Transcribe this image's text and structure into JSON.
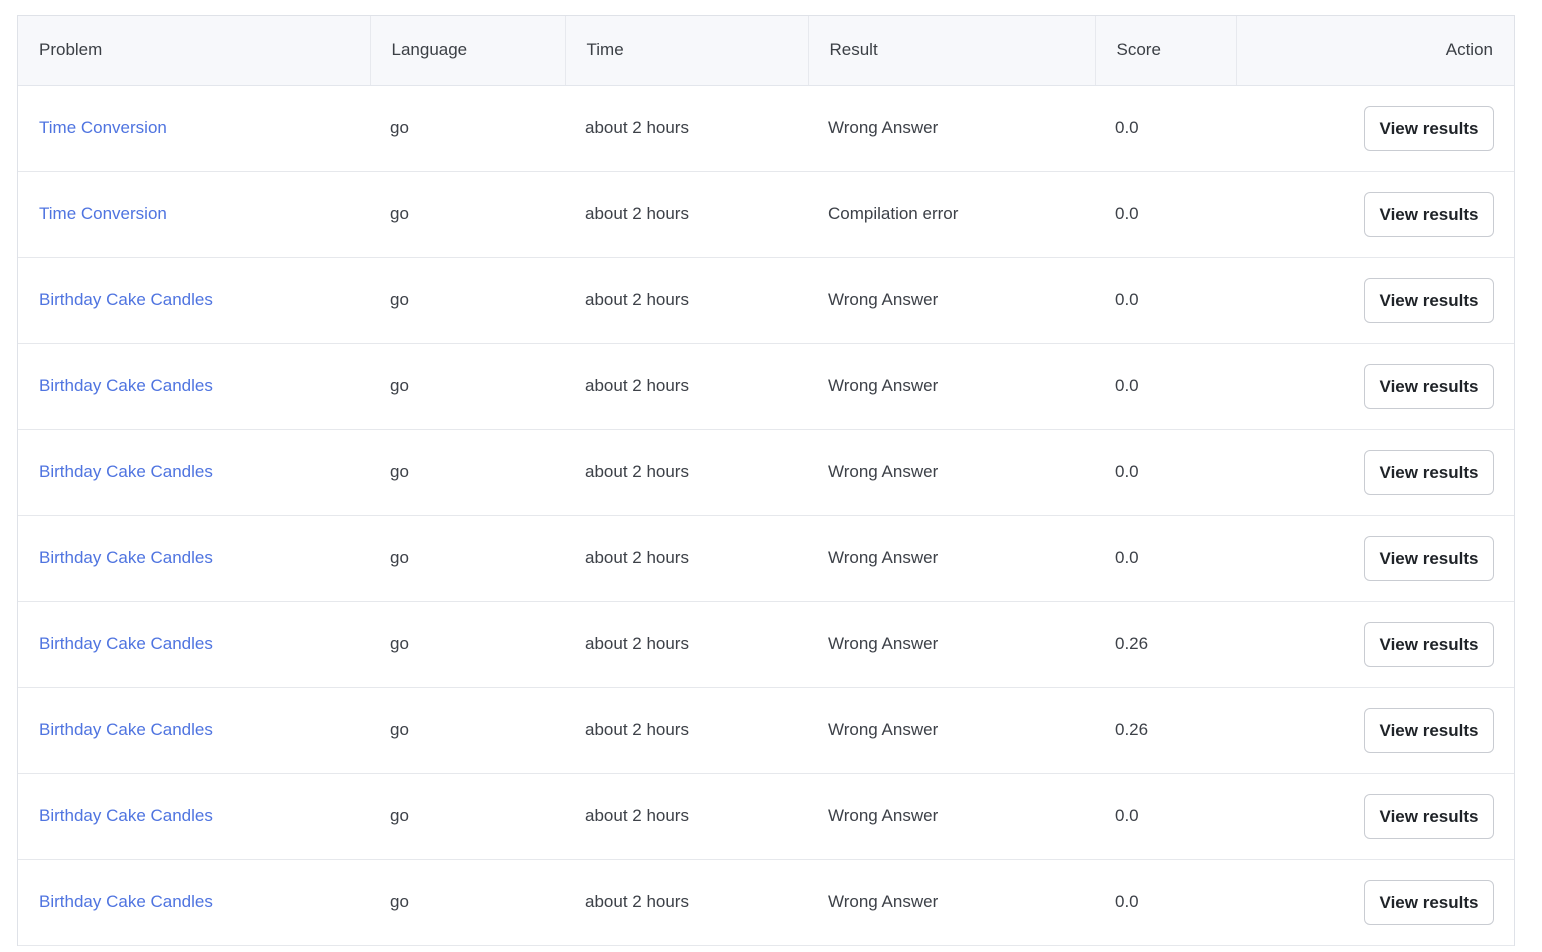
{
  "table": {
    "headers": {
      "problem": "Problem",
      "language": "Language",
      "time": "Time",
      "result": "Result",
      "score": "Score",
      "action": "Action"
    },
    "rows": [
      {
        "problem": "Time Conversion",
        "language": "go",
        "time": "about 2 hours",
        "result": "Wrong Answer",
        "score": "0.0",
        "action": "View results"
      },
      {
        "problem": "Time Conversion",
        "language": "go",
        "time": "about 2 hours",
        "result": "Compilation error",
        "score": "0.0",
        "action": "View results"
      },
      {
        "problem": "Birthday Cake Candles",
        "language": "go",
        "time": "about 2 hours",
        "result": "Wrong Answer",
        "score": "0.0",
        "action": "View results"
      },
      {
        "problem": "Birthday Cake Candles",
        "language": "go",
        "time": "about 2 hours",
        "result": "Wrong Answer",
        "score": "0.0",
        "action": "View results"
      },
      {
        "problem": "Birthday Cake Candles",
        "language": "go",
        "time": "about 2 hours",
        "result": "Wrong Answer",
        "score": "0.0",
        "action": "View results"
      },
      {
        "problem": "Birthday Cake Candles",
        "language": "go",
        "time": "about 2 hours",
        "result": "Wrong Answer",
        "score": "0.0",
        "action": "View results"
      },
      {
        "problem": "Birthday Cake Candles",
        "language": "go",
        "time": "about 2 hours",
        "result": "Wrong Answer",
        "score": "0.26",
        "action": "View results"
      },
      {
        "problem": "Birthday Cake Candles",
        "language": "go",
        "time": "about 2 hours",
        "result": "Wrong Answer",
        "score": "0.26",
        "action": "View results"
      },
      {
        "problem": "Birthday Cake Candles",
        "language": "go",
        "time": "about 2 hours",
        "result": "Wrong Answer",
        "score": "0.0",
        "action": "View results"
      },
      {
        "problem": "Birthday Cake Candles",
        "language": "go",
        "time": "about 2 hours",
        "result": "Wrong Answer",
        "score": "0.0",
        "action": "View results"
      }
    ]
  },
  "colors": {
    "link": "#4f74e0",
    "header_bg": "#f7f8fb",
    "border": "#e6e8ec"
  }
}
